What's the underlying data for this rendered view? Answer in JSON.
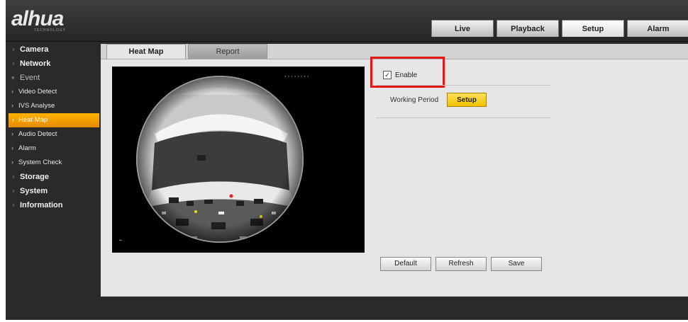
{
  "brand": {
    "logo": "alhua",
    "tagline": "TECHNOLOGY"
  },
  "top_tabs": [
    {
      "label": "Live"
    },
    {
      "label": "Playback"
    },
    {
      "label": "Setup"
    },
    {
      "label": "Alarm"
    }
  ],
  "sidebar": {
    "items": [
      {
        "label": "Camera"
      },
      {
        "label": "Network"
      },
      {
        "label": "Event"
      },
      {
        "label": "Video Detect"
      },
      {
        "label": "IVS Analyse"
      },
      {
        "label": "Heat Map"
      },
      {
        "label": "Audio Detect"
      },
      {
        "label": "Alarm"
      },
      {
        "label": "System Check"
      },
      {
        "label": "Storage"
      },
      {
        "label": "System"
      },
      {
        "label": "Information"
      }
    ]
  },
  "content_tabs": [
    {
      "label": "Heat Map"
    },
    {
      "label": "Report"
    }
  ],
  "form": {
    "enable_label": "Enable",
    "enable_checked": true,
    "working_period_label": "Working Period",
    "setup_label": "Setup"
  },
  "buttons": {
    "default": "Default",
    "refresh": "Refresh",
    "save": "Save"
  },
  "colors": {
    "accent_orange": "#f5a000",
    "setup_yellow": "#f6c800",
    "highlight_red": "#e01818"
  }
}
